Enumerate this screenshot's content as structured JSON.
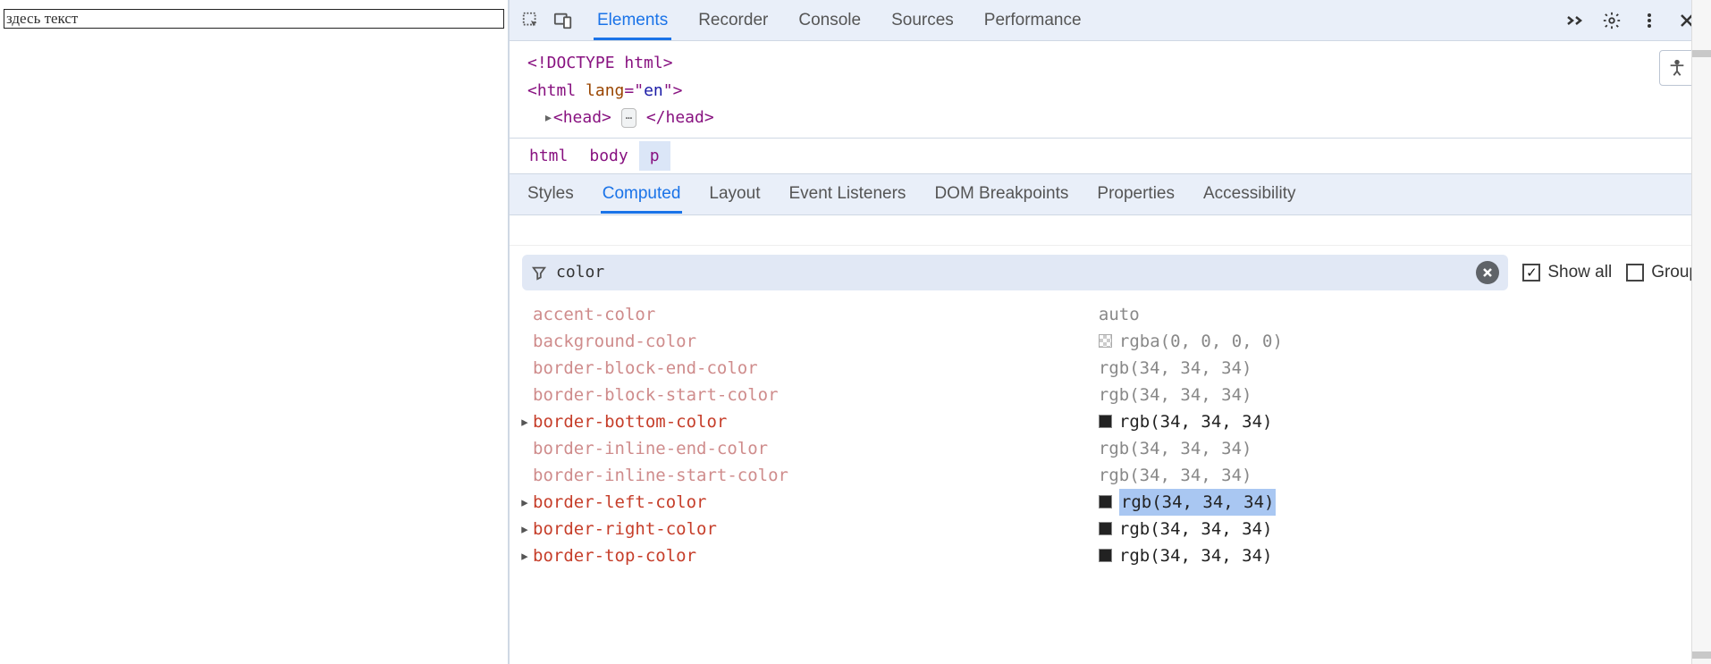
{
  "page": {
    "paragraph_text": "здесь текст"
  },
  "toolbar": {
    "tabs": {
      "elements": "Elements",
      "recorder": "Recorder",
      "console": "Console",
      "sources": "Sources",
      "performance": "Performance"
    }
  },
  "dom": {
    "line1": "<!DOCTYPE html>",
    "line2_open": "<",
    "line2_tag": "html",
    "line2_attr": " lang",
    "line2_eq": "=\"",
    "line2_val": "en",
    "line2_close": "\">",
    "line3_arrow": "▸",
    "line3_open": "<",
    "line3_head": "head",
    "line3_gt": ">",
    "line3_dots": "⋯",
    "line3_close_open": "</",
    "line3_close_gt": ">"
  },
  "breadcrumb": {
    "a": "html",
    "b": "body",
    "c": "p"
  },
  "subtabs": {
    "styles": "Styles",
    "computed": "Computed",
    "layout": "Layout",
    "listeners": "Event Listeners",
    "dom_bp": "DOM Breakpoints",
    "properties": "Properties",
    "accessibility": "Accessibility"
  },
  "filter": {
    "value": "color",
    "show_all": "Show all",
    "group": "Group"
  },
  "props": [
    {
      "name": "accent-color",
      "value": "auto",
      "strong": false,
      "arrow": false,
      "swatch": null
    },
    {
      "name": "background-color",
      "value": "rgba(0, 0, 0, 0)",
      "strong": false,
      "arrow": false,
      "swatch": "checker"
    },
    {
      "name": "border-block-end-color",
      "value": "rgb(34, 34, 34)",
      "strong": false,
      "arrow": false,
      "swatch": null
    },
    {
      "name": "border-block-start-color",
      "value": "rgb(34, 34, 34)",
      "strong": false,
      "arrow": false,
      "swatch": null
    },
    {
      "name": "border-bottom-color",
      "value": "rgb(34, 34, 34)",
      "strong": true,
      "arrow": true,
      "swatch": "#222"
    },
    {
      "name": "border-inline-end-color",
      "value": "rgb(34, 34, 34)",
      "strong": false,
      "arrow": false,
      "swatch": null
    },
    {
      "name": "border-inline-start-color",
      "value": "rgb(34, 34, 34)",
      "strong": false,
      "arrow": false,
      "swatch": null
    },
    {
      "name": "border-left-color",
      "value": "rgb(34, 34, 34)",
      "strong": true,
      "arrow": true,
      "swatch": "#222",
      "selected": true
    },
    {
      "name": "border-right-color",
      "value": "rgb(34, 34, 34)",
      "strong": true,
      "arrow": true,
      "swatch": "#222"
    },
    {
      "name": "border-top-color",
      "value": "rgb(34, 34, 34)",
      "strong": true,
      "arrow": true,
      "swatch": "#222"
    }
  ]
}
